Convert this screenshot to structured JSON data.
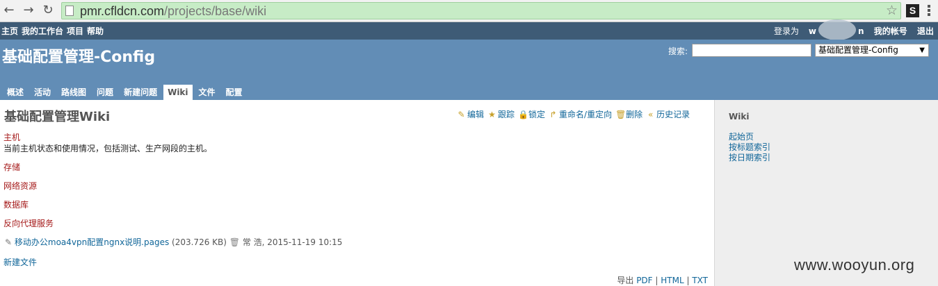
{
  "browser": {
    "back": "←",
    "forward": "→",
    "reload": "↻",
    "url_host": "pmr.cfldcn.com",
    "url_path": "/projects/base/wiki",
    "star": "☆",
    "ext_label": "S"
  },
  "top_menu": {
    "items": [
      "主页",
      "我的工作台",
      "项目",
      "帮助"
    ],
    "logged_as_label": "登录为",
    "logged_user_visible_start": "w",
    "logged_user_visible_end": "n",
    "account": "我的帐号",
    "logout": "退出"
  },
  "header": {
    "title": "基础配置管理-Config",
    "search_label": "搜索:",
    "search_value": "",
    "project_select": "基础配置管理-Config",
    "select_arrow": "▼"
  },
  "tabs": [
    {
      "label": "概述",
      "selected": false
    },
    {
      "label": "活动",
      "selected": false
    },
    {
      "label": "路线图",
      "selected": false
    },
    {
      "label": "问题",
      "selected": false
    },
    {
      "label": "新建问题",
      "selected": false
    },
    {
      "label": "Wiki",
      "selected": true
    },
    {
      "label": "文件",
      "selected": false
    },
    {
      "label": "配置",
      "selected": false
    }
  ],
  "wiki": {
    "title": "基础配置管理Wiki",
    "actions": [
      {
        "icon": "edit-icon",
        "glyph": "✎",
        "label": "编辑"
      },
      {
        "icon": "watch-icon",
        "glyph": "★",
        "label": "跟踪"
      },
      {
        "icon": "lock-icon",
        "glyph": "🔒",
        "label": "锁定"
      },
      {
        "icon": "rename-icon",
        "glyph": "↱",
        "label": "重命名/重定向"
      },
      {
        "icon": "delete-icon",
        "glyph": "🗑",
        "label": "删除"
      },
      {
        "icon": "history-icon",
        "glyph": "«",
        "label": "历史记录"
      }
    ],
    "host_link": "主机",
    "host_desc": "当前主机状态和使用情况，包括测试、生产网段的主机。",
    "links": [
      "存储",
      "网络资源",
      "数据库",
      "反向代理服务"
    ],
    "attachment": {
      "filename": "移动办公moa4vpn配置ngnx说明.pages",
      "size": "(203.726 KB)",
      "author_date": "常 浩, 2015-11-19 10:15"
    },
    "new_file": "新建文件",
    "export_label": "导出",
    "export_formats": [
      "PDF",
      "HTML",
      "TXT"
    ]
  },
  "sidebar": {
    "title": "Wiki",
    "links": [
      "起始页",
      "按标题索引",
      "按日期索引"
    ]
  },
  "watermark": "www.wooyun.org",
  "colors": {
    "top_menu_bg": "#3e5b76",
    "header_bg": "#628db6",
    "link": "#116699",
    "wiki_link": "#a51a1a",
    "address_bar": "#c7ecc6"
  }
}
